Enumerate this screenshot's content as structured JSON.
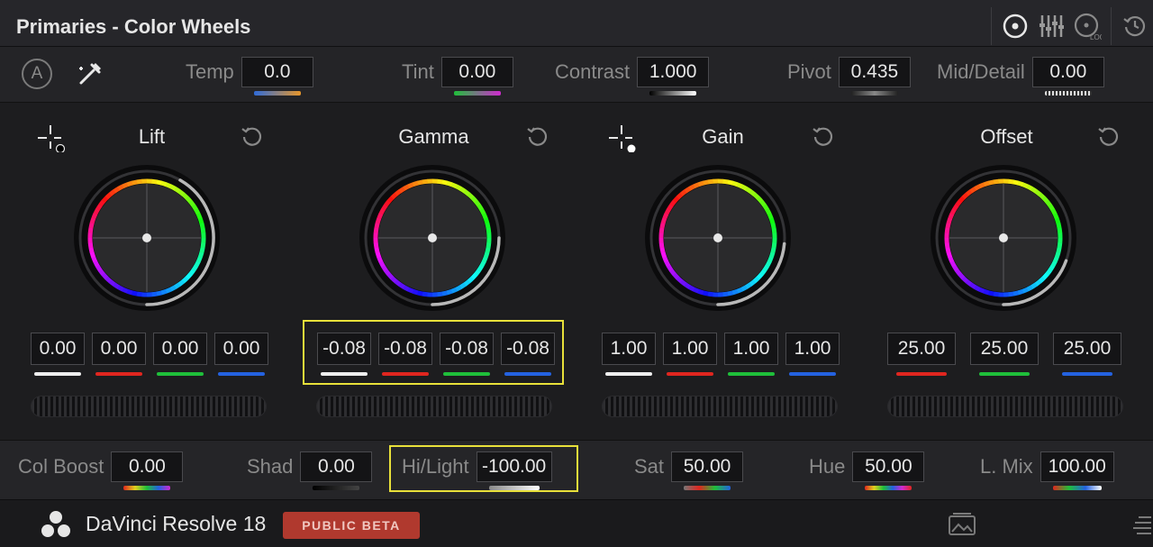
{
  "header": {
    "title": "Primaries - Color Wheels"
  },
  "mode_icons": [
    "color-wheels-icon",
    "bars-icon",
    "log-wheels-icon",
    "reset-all-icon"
  ],
  "toolbar": {
    "auto_label": "A",
    "params": [
      {
        "label": "Temp",
        "value": "0.0"
      },
      {
        "label": "Tint",
        "value": "0.00"
      },
      {
        "label": "Contrast",
        "value": "1.000"
      },
      {
        "label": "Pivot",
        "value": "0.435"
      },
      {
        "label": "Mid/Detail",
        "value": "0.00"
      }
    ]
  },
  "wheels": [
    {
      "title": "Lift",
      "values": [
        "0.00",
        "0.00",
        "0.00",
        "0.00"
      ],
      "indicator_degrees": 150
    },
    {
      "title": "Gamma",
      "values": [
        "-0.08",
        "-0.08",
        "-0.08",
        "-0.08"
      ],
      "indicator_degrees": 90
    },
    {
      "title": "Gain",
      "values": [
        "1.00",
        "1.00",
        "1.00",
        "1.00"
      ],
      "indicator_degrees": 85
    },
    {
      "title": "Offset",
      "values": [
        "25.00",
        "25.00",
        "25.00"
      ],
      "indicator_degrees": 70
    }
  ],
  "bottom": {
    "params": [
      {
        "label": "Col Boost",
        "value": "0.00"
      },
      {
        "label": "Shad",
        "value": "0.00"
      },
      {
        "label": "Hi/Light",
        "value": "-100.00"
      },
      {
        "label": "Sat",
        "value": "50.00"
      },
      {
        "label": "Hue",
        "value": "50.00"
      },
      {
        "label": "L. Mix",
        "value": "100.00"
      }
    ]
  },
  "status": {
    "app_name": "DaVinci Resolve 18",
    "badge": "PUBLIC BETA"
  },
  "colors": {
    "highlight": "#e8e03a",
    "red": "#e0261f",
    "green": "#1fbf3a",
    "blue": "#2462e0",
    "white": "#eeeeee",
    "badge": "#b0392e"
  }
}
